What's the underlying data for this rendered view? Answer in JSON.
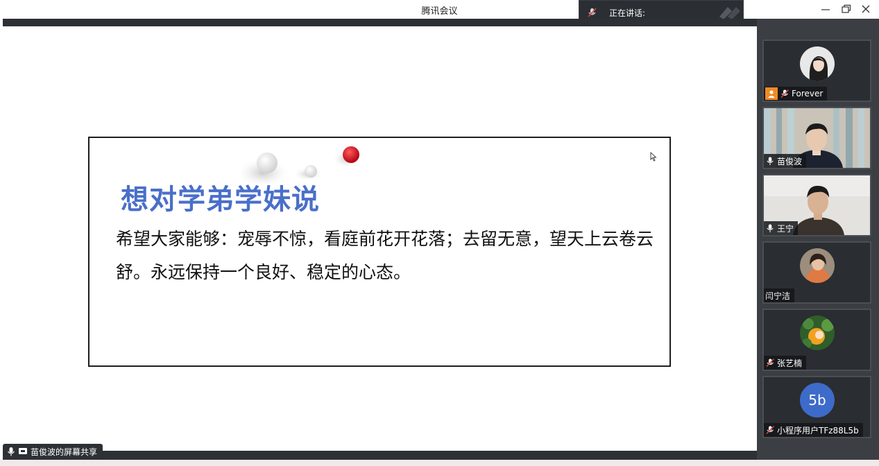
{
  "window": {
    "title": "腾讯会议",
    "speaking_label": "正在讲话:"
  },
  "slide": {
    "title": "想对学弟学妹说",
    "body": "希望大家能够：宠辱不惊，看庭前花开花落；去留无意，望天上云卷云舒。永远保持一个良好、稳定的心态。"
  },
  "share_label": "苗俊波的屏幕共享",
  "participants": [
    {
      "name": "Forever",
      "role": "host",
      "mic": "muted",
      "view": "avatar"
    },
    {
      "name": "苗俊波",
      "mic": "on",
      "view": "video"
    },
    {
      "name": "王宁",
      "mic": "on",
      "view": "video"
    },
    {
      "name": "闫宁洁",
      "mic": "none",
      "view": "avatar"
    },
    {
      "name": "张艺楠",
      "mic": "muted",
      "view": "avatar"
    },
    {
      "name": "小程序用户TFz88L5b",
      "mic": "muted",
      "view": "initials",
      "initials": "5b"
    }
  ],
  "colors": {
    "title_accent": "#4a6fc9",
    "host_badge": "#f08a24",
    "initials_avatar": "#3d6bc9",
    "muted_icon": "#e04040"
  }
}
